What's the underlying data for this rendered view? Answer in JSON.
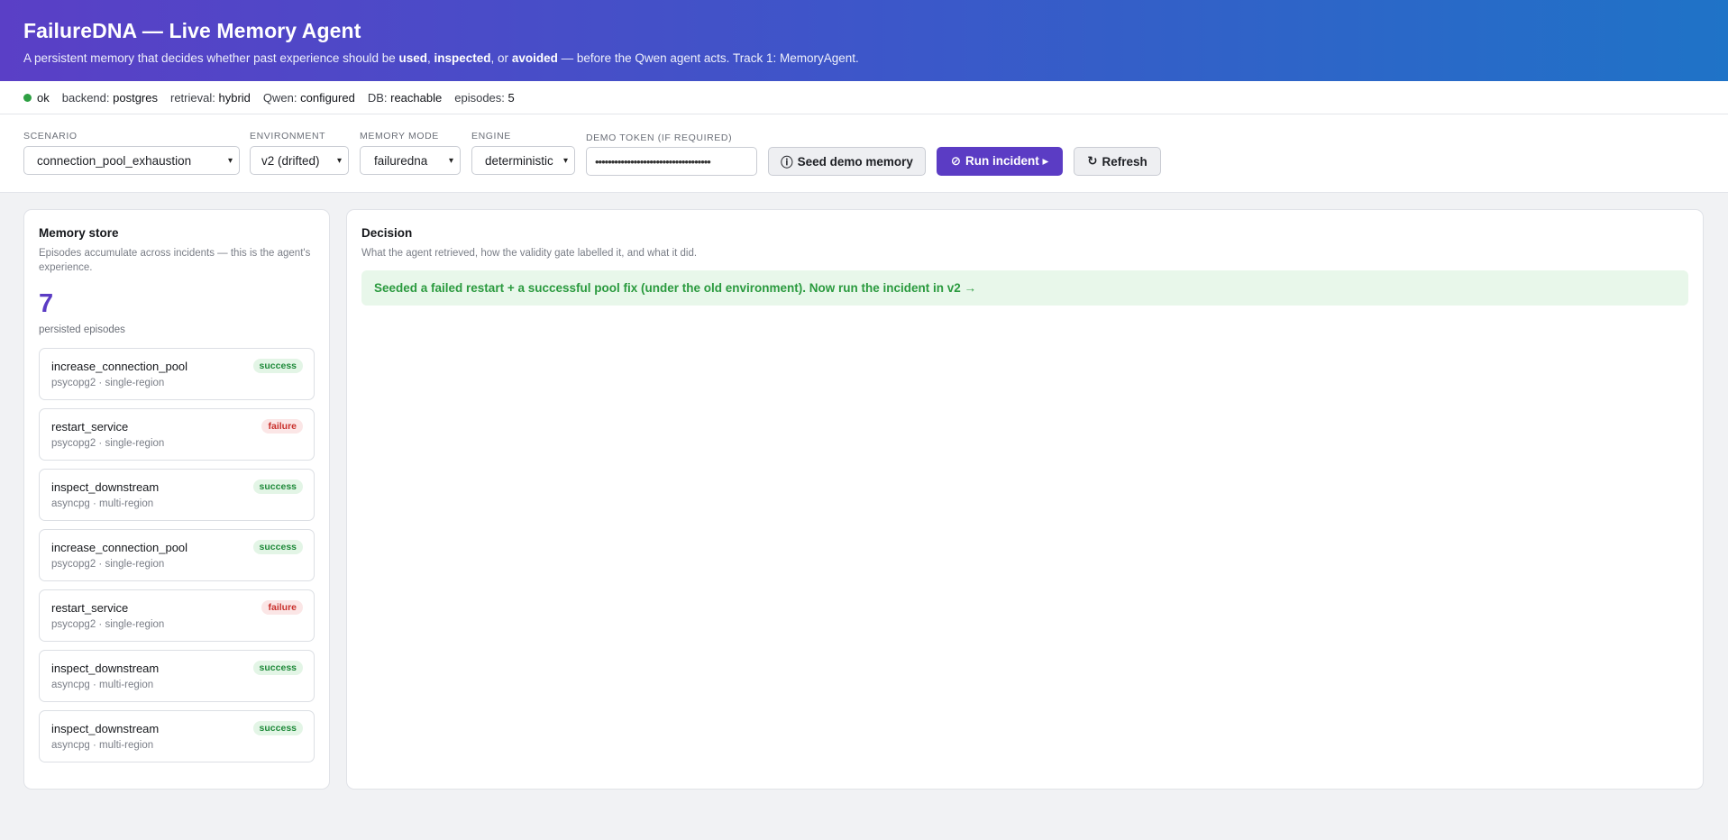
{
  "header": {
    "title": "FailureDNA — Live Memory Agent",
    "subtitle_parts": {
      "p1": "A persistent memory that decides whether past experience should be ",
      "used": "used",
      "p2": ", ",
      "inspected": "inspected",
      "p3": ", or ",
      "avoided": "avoided",
      "p4": " — before the Qwen agent acts. Track 1: MemoryAgent."
    }
  },
  "status": {
    "state": "ok",
    "backend_key": "backend:",
    "backend_val": "postgres",
    "retrieval_key": "retrieval:",
    "retrieval_val": "hybrid",
    "qwen_key": "Qwen:",
    "qwen_val": "configured",
    "db_key": "DB:",
    "db_val": "reachable",
    "episodes_key": "episodes:",
    "episodes_val": "5",
    "colors": {
      "ok_dot": "#2ea043"
    }
  },
  "toolbar": {
    "scenario": {
      "label": "Scenario",
      "value": "connection_pool_exhaustion"
    },
    "environment": {
      "label": "Environment",
      "value": "v2 (drifted)"
    },
    "memory_mode": {
      "label": "Memory mode",
      "value": "failuredna"
    },
    "engine": {
      "label": "Engine",
      "value": "deterministic"
    },
    "token": {
      "label": "Demo token (if required)",
      "value": "••••••••••••••••••••••••••••••••••••"
    },
    "seed": {
      "icon": "ⓘ",
      "label": "Seed demo memory"
    },
    "run": {
      "icon": "⊘",
      "label": "Run incident ▸"
    },
    "refresh": {
      "icon": "↻",
      "label": "Refresh"
    },
    "caret": "▾"
  },
  "memory_store": {
    "title": "Memory store",
    "subtitle": "Episodes accumulate across incidents — this is the agent's experience.",
    "count": "7",
    "count_label": "persisted episodes",
    "episodes": [
      {
        "action": "increase_connection_pool",
        "env": "psycopg2 · single-region",
        "outcome": "success"
      },
      {
        "action": "restart_service",
        "env": "psycopg2 · single-region",
        "outcome": "failure"
      },
      {
        "action": "inspect_downstream",
        "env": "asyncpg · multi-region",
        "outcome": "success"
      },
      {
        "action": "increase_connection_pool",
        "env": "psycopg2 · single-region",
        "outcome": "success"
      },
      {
        "action": "restart_service",
        "env": "psycopg2 · single-region",
        "outcome": "failure"
      },
      {
        "action": "inspect_downstream",
        "env": "asyncpg · multi-region",
        "outcome": "success"
      },
      {
        "action": "inspect_downstream",
        "env": "asyncpg · multi-region",
        "outcome": "success"
      }
    ]
  },
  "decision": {
    "title": "Decision",
    "subtitle": "What the agent retrieved, how the validity gate labelled it, and what it did.",
    "notice": "Seeded a failed restart + a successful pool fix (under the old environment). Now run the incident in v2 →"
  },
  "colors": {
    "accent": "#5b3cc4",
    "success_text": "#1f8a3a",
    "failure_text": "#c9302c",
    "notice_bg": "#e8f7ea"
  }
}
